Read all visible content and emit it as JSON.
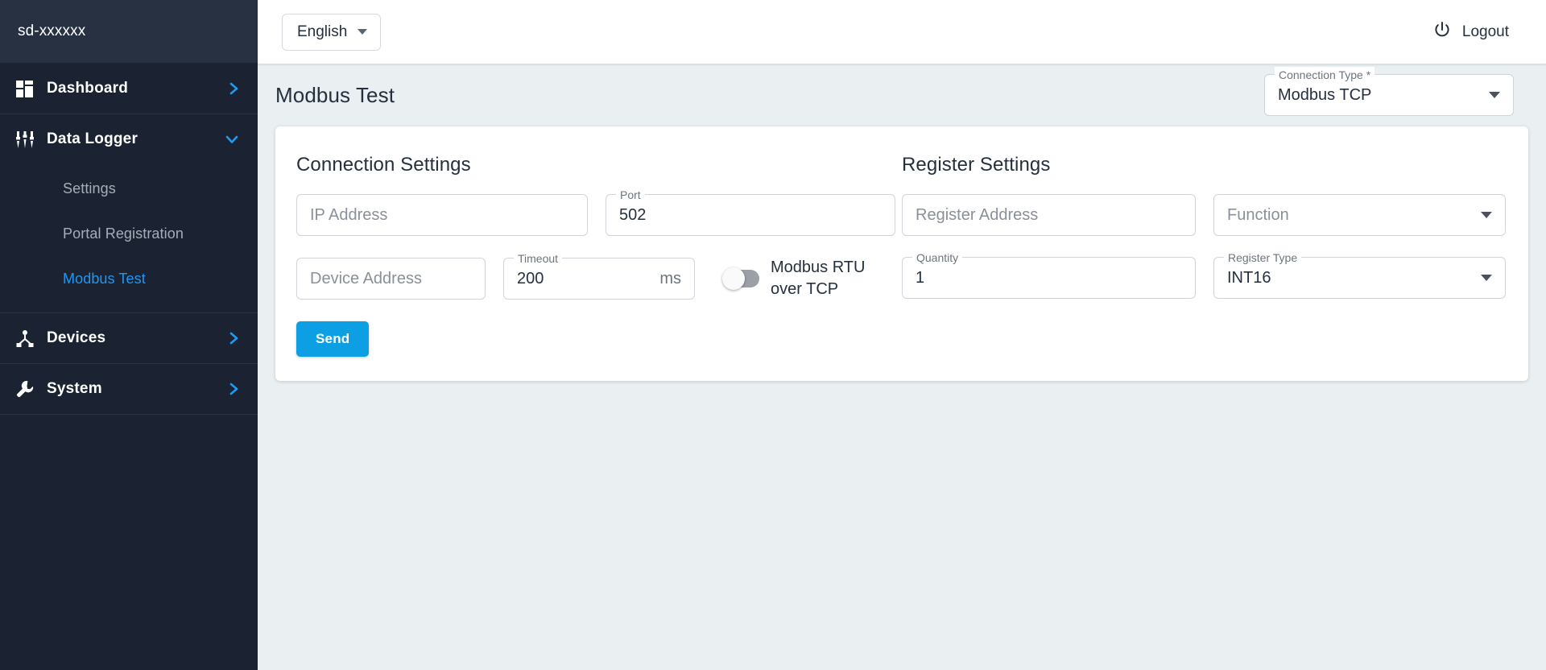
{
  "sidebar": {
    "brand": "sd-xxxxxx",
    "items": [
      {
        "label": "Dashboard",
        "icon": "dashboard-icon",
        "chevron": "chevron-right-icon"
      },
      {
        "label": "Data Logger",
        "icon": "sliders-icon",
        "chevron": "chevron-down-icon"
      },
      {
        "label": "Devices",
        "icon": "device-tree-icon",
        "chevron": "chevron-right-icon"
      },
      {
        "label": "System",
        "icon": "wrench-icon",
        "chevron": "chevron-right-icon"
      }
    ],
    "data_logger_children": [
      {
        "label": "Settings",
        "active": false
      },
      {
        "label": "Portal Registration",
        "active": false
      },
      {
        "label": "Modbus Test",
        "active": true
      }
    ]
  },
  "topbar": {
    "language_value": "English",
    "language_caret": "chevron-down-icon",
    "logout_label": "Logout",
    "logout_icon": "power-icon"
  },
  "page": {
    "title": "Modbus Test",
    "connection_type": {
      "legend": "Connection Type *",
      "value": "Modbus TCP",
      "arrow": "chevron-down-icon"
    }
  },
  "connection_settings": {
    "title": "Connection Settings",
    "ip_address": {
      "placeholder": "IP Address",
      "value": ""
    },
    "port": {
      "legend": "Port",
      "value": "502"
    },
    "device_address": {
      "placeholder": "Device Address",
      "value": ""
    },
    "timeout": {
      "legend": "Timeout",
      "value": "200",
      "suffix": "ms"
    },
    "rtu_over_tcp": {
      "label_line1": "Modbus RTU",
      "label_line2": "over TCP",
      "state": "off"
    },
    "send_label": "Send"
  },
  "register_settings": {
    "title": "Register Settings",
    "register_address": {
      "placeholder": "Register Address",
      "value": ""
    },
    "function": {
      "placeholder": "Function",
      "value": "",
      "arrow": "chevron-down-icon"
    },
    "quantity": {
      "legend": "Quantity",
      "value": "1"
    },
    "register_type": {
      "legend": "Register Type",
      "value": "INT16",
      "arrow": "chevron-down-icon"
    }
  },
  "colors": {
    "sidebar_bg": "#1b2332",
    "brand_bg": "#273142",
    "accent": "#2196f3",
    "button": "#0c9fe4",
    "content_bg": "#eaeff2",
    "text_dark": "#25303f"
  }
}
